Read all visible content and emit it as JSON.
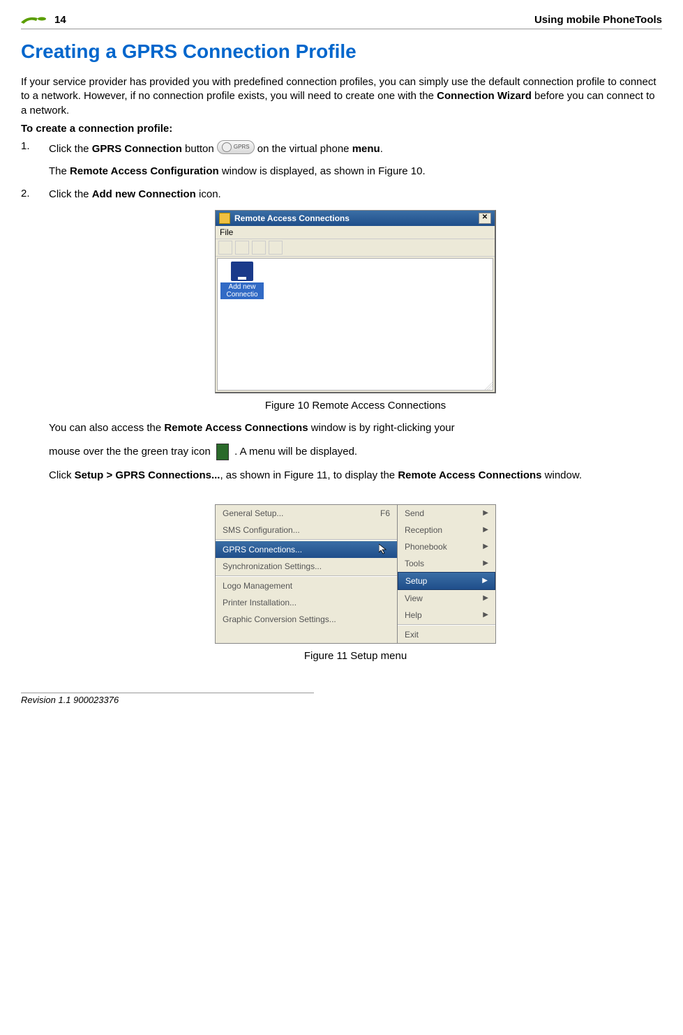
{
  "header": {
    "pageNumber": "14",
    "rightText": "Using mobile PhoneTools"
  },
  "title": "Creating a GPRS Connection Profile",
  "intro": "If your service provider has provided you with predefined connection profiles, you can simply use the default connection profile to connect to a network. However, if no connection profile exists, you will need to create one with the Connection Wizard before you can connect to a network.",
  "subhead": "To create a connection profile:",
  "step1": {
    "num": "1.",
    "pre": "Click the ",
    "bold1": "GPRS Connection",
    "mid": " button ",
    "post": " on the virtual phone ",
    "bold2": "menu",
    "period": ".",
    "gprsLabel": "GPRS"
  },
  "step1followup": {
    "pre": "The ",
    "bold": "Remote Access Configuration",
    "post": " window is displayed, as shown in Figure 10."
  },
  "step2": {
    "num": "2.",
    "pre": "Click the ",
    "bold": "Add new Connection",
    "post": " icon."
  },
  "racWindow": {
    "title": "Remote Access Connections",
    "menuFile": "File",
    "itemLabel1": "Add new",
    "itemLabel2": "Connectio"
  },
  "figure10": "Figure 10 Remote Access Connections",
  "access": {
    "pre": "You can also access the ",
    "bold": "Remote Access Connections",
    "post": " window is by right-clicking your"
  },
  "access2": {
    "pre": "mouse over the the green tray icon ",
    "post": " . A menu will be displayed."
  },
  "clickSetup": {
    "pre": "Click ",
    "bold1": "Setup > GPRS Connections...",
    "mid": ", as shown in Figure 11, to display the ",
    "bold2": "Remote Access Connections",
    "post": " window."
  },
  "leftMenu": {
    "items": [
      {
        "label": "General Setup...",
        "shortcut": "F6"
      },
      {
        "label": "SMS Configuration..."
      }
    ],
    "highlight": "GPRS Connections...",
    "items2": [
      {
        "label": "Synchronization Settings..."
      }
    ],
    "items3": [
      {
        "label": "Logo Management"
      },
      {
        "label": "Printer Installation..."
      },
      {
        "label": "Graphic Conversion Settings..."
      }
    ]
  },
  "rightMenu": {
    "items1": [
      "Send",
      "Reception",
      "Phonebook",
      "Tools"
    ],
    "highlight": "Setup",
    "items2": [
      "View",
      "Help"
    ],
    "exit": "Exit"
  },
  "figure11": "Figure 11 Setup menu",
  "footer": "Revision 1.1 900023376"
}
